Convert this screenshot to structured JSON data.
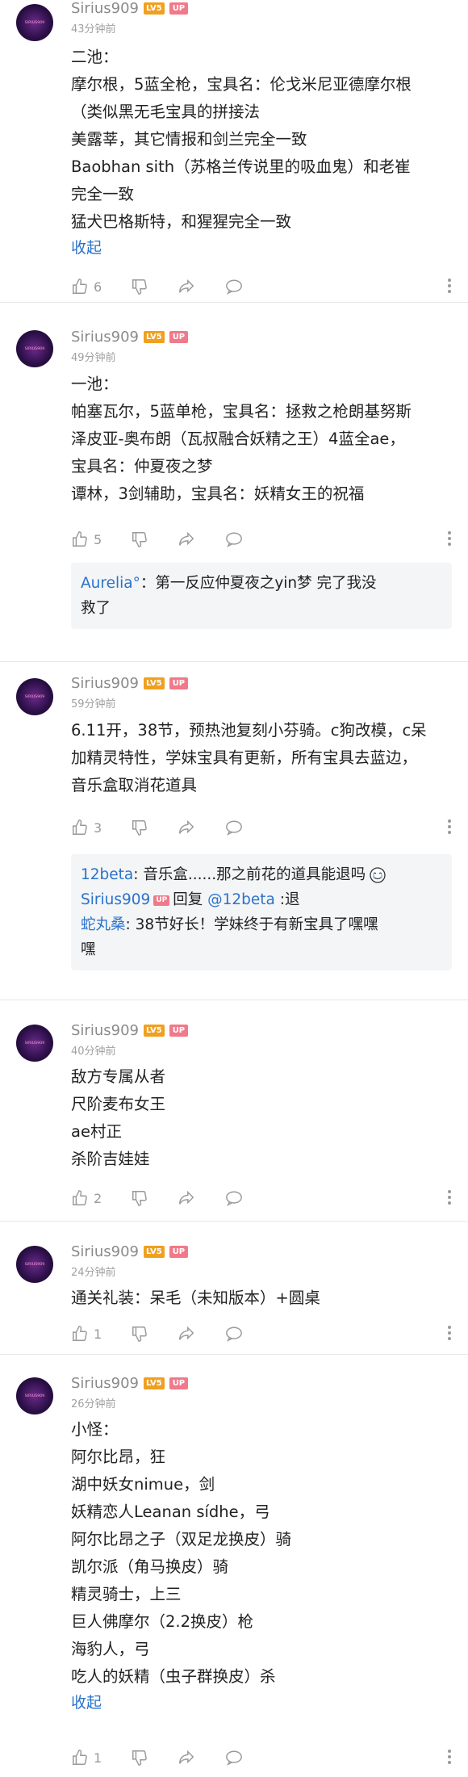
{
  "comments": [
    {
      "username": "Sirius909",
      "level": "LV5",
      "up": "UP",
      "avatar_text": "SIRIUS909",
      "time": "43分钟前",
      "lines": [
        "二池：",
        "摩尔根，5蓝全枪，宝具名：伦戈米尼亚德摩尔根",
        "（类似黑无毛宝具的拼接法",
        "美露莘，其它情报和剑兰完全一致",
        "Baobhan sith（苏格兰传说里的吸血鬼）和老崔",
        "完全一致",
        "猛犬巴格斯特，和猩猩完全一致"
      ],
      "collapse": "收起",
      "likes": "6"
    },
    {
      "username": "Sirius909",
      "level": "LV5",
      "up": "UP",
      "avatar_text": "SIRIUS909",
      "time": "49分钟前",
      "lines": [
        "一池：",
        "帕塞瓦尔，5蓝单枪，宝具名：拯救之枪朗基努斯",
        "泽皮亚-奥布朗（瓦叔融合妖精之王）4蓝全ae，",
        "宝具名：仲夏夜之梦",
        "谭林，3剑辅助，宝具名：妖精女王的祝福"
      ],
      "likes": "5",
      "replies": [
        {
          "name": "Aurelia°",
          "text": "：第一反应仲夏夜之yin梦 完了我没"
        },
        {
          "name": "",
          "text": "救了"
        }
      ]
    },
    {
      "username": "Sirius909",
      "level": "LV5",
      "up": "UP",
      "avatar_text": "SIRIUS909",
      "time": "59分钟前",
      "lines": [
        "6.11开，38节，预热池复刻小芬骑。c狗改模，c呆",
        "加精灵特性，学妹宝具有更新，所有宝具去蓝边，",
        "音乐盒取消花道具"
      ],
      "likes": "3",
      "replies": [
        {
          "name": "12beta",
          "text": ": 音乐盒......那之前花的道具能退吗"
        },
        {
          "name": "Sirius909",
          "up": "UP",
          "text_pre": "回复 ",
          "mention": "@12beta",
          "text": " :退"
        },
        {
          "name": "蛇丸桑",
          "text": ": 38节好长！学妹终于有新宝具了嘿嘿"
        },
        {
          "name": "",
          "text": "嘿"
        }
      ]
    },
    {
      "username": "Sirius909",
      "level": "LV5",
      "up": "UP",
      "avatar_text": "SIRIUS909",
      "time": "40分钟前",
      "lines": [
        "敌方专属从者",
        "尺阶麦布女王",
        "ae村正",
        "杀阶吉娃娃"
      ],
      "likes": "2"
    },
    {
      "username": "Sirius909",
      "level": "LV5",
      "up": "UP",
      "avatar_text": "SIRIUS909",
      "time": "24分钟前",
      "lines": [
        "通关礼装：呆毛（未知版本）+圆桌"
      ],
      "likes": "1"
    },
    {
      "username": "Sirius909",
      "level": "LV5",
      "up": "UP",
      "avatar_text": "SIRIUS909",
      "time": "26分钟前",
      "lines": [
        "小怪：",
        "阿尔比昂，狂",
        "湖中妖女nimue，剑",
        "妖精恋人Leanan sídhe，弓",
        "阿尔比昂之子（双足龙换皮）骑",
        "凯尔派（角马换皮）骑",
        "精灵骑士，上三",
        "巨人佛摩尔（2.2换皮）枪",
        "海豹人，弓",
        "吃人的妖精（虫子群换皮）杀"
      ],
      "collapse": "收起",
      "likes": "1"
    }
  ]
}
